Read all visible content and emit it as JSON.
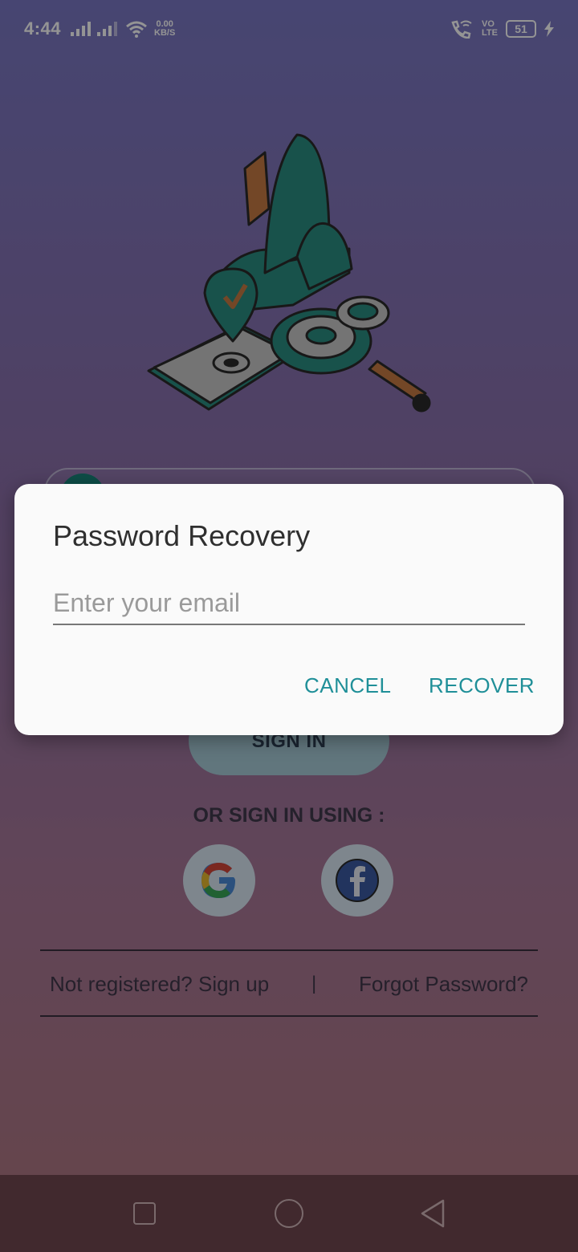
{
  "status_bar": {
    "time": "4:44",
    "net_speed_value": "0.00",
    "net_speed_unit": "KB/S",
    "volte_top": "VO",
    "volte_bottom": "LTE",
    "battery": "51"
  },
  "login": {
    "signin_label": "SIGN IN",
    "or_text": "OR SIGN IN USING :",
    "signup_link": "Not registered? Sign up",
    "separator": "|",
    "forgot_link": "Forgot Password?"
  },
  "dialog": {
    "title": "Password Recovery",
    "email_placeholder": "Enter your email",
    "email_value": "",
    "cancel_label": "CANCEL",
    "recover_label": "RECOVER"
  },
  "colors": {
    "accent": "#1f8f98",
    "dialog_bg": "#fafafa",
    "nav_bar": "#41292e"
  }
}
